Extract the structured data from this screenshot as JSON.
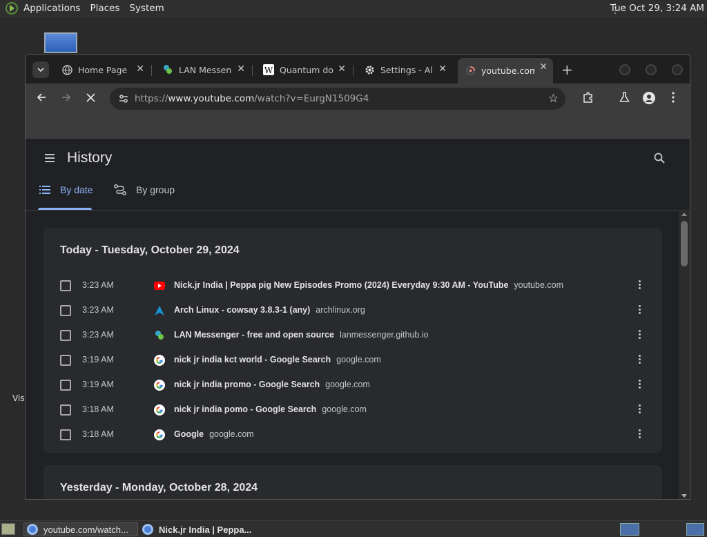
{
  "top_panel": {
    "menus": [
      "Applications",
      "Places",
      "System"
    ],
    "clock": "Tue Oct 29,  3:24 AM"
  },
  "desktop": {
    "partial_label": "Vis"
  },
  "browser": {
    "tabs": [
      {
        "title": "Home Page",
        "icon": "globe-icon"
      },
      {
        "title": "LAN Messen",
        "icon": "lan-messenger-icon"
      },
      {
        "title": "Quantum do",
        "icon": "wikipedia-icon"
      },
      {
        "title": "Settings - Al",
        "icon": "gear-icon"
      },
      {
        "title": "youtube.com",
        "icon": "loading-icon",
        "active": true
      }
    ],
    "url_prefix": "https://",
    "url_host": "www.youtube.com",
    "url_path": "/watch?v=EurgN1509G4"
  },
  "history": {
    "title": "History",
    "tabs": {
      "by_date": "By date",
      "by_group": "By group"
    },
    "sections": [
      {
        "heading": "Today - Tuesday, October 29, 2024",
        "entries": [
          {
            "time": "3:23 AM",
            "title": "Nick.jr India | Peppa pig New Episodes Promo (2024) Everyday 9:30 AM - YouTube",
            "domain": "youtube.com",
            "icon": "youtube-icon"
          },
          {
            "time": "3:23 AM",
            "title": "Arch Linux - cowsay 3.8.3-1 (any)",
            "domain": "archlinux.org",
            "icon": "arch-linux-icon"
          },
          {
            "time": "3:23 AM",
            "title": "LAN Messenger - free and open source",
            "domain": "lanmessenger.github.io",
            "icon": "lan-messenger-icon"
          },
          {
            "time": "3:19 AM",
            "title": "nick jr india kct world - Google Search",
            "domain": "google.com",
            "icon": "google-icon"
          },
          {
            "time": "3:19 AM",
            "title": "nick jr india promo - Google Search",
            "domain": "google.com",
            "icon": "google-icon"
          },
          {
            "time": "3:18 AM",
            "title": "nick jr india pomo - Google Search",
            "domain": "google.com",
            "icon": "google-icon"
          },
          {
            "time": "3:18 AM",
            "title": "Google",
            "domain": "google.com",
            "icon": "google-icon"
          }
        ]
      },
      {
        "heading": "Yesterday - Monday, October 28, 2024"
      }
    ]
  },
  "taskbar": {
    "tasks": [
      "youtube.com/watch...",
      "Nick.jr India | Peppa..."
    ]
  },
  "colors": {
    "accent": "#8ab4f8",
    "card": "#292a2d",
    "page": "#202124",
    "youtube_red": "#ff0000"
  }
}
